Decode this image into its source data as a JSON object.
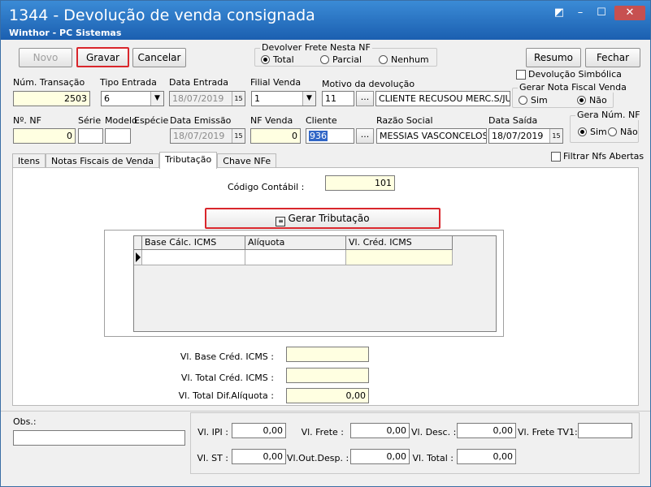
{
  "window": {
    "title": "1344 - Devolução de venda consignada",
    "subtitle": "Winthor - PC Sistemas"
  },
  "toolbar": {
    "novo": "Novo",
    "gravar": "Gravar",
    "cancelar": "Cancelar",
    "resumo": "Resumo",
    "fechar": "Fechar"
  },
  "frete": {
    "title": "Devolver Frete Nesta NF",
    "options": [
      "Total",
      "Parcial",
      "Nenhum"
    ],
    "selected": "Total"
  },
  "devolucao_simbolica": "Devolução Simbólica",
  "gerar_nota": {
    "title": "Gerar Nota Fiscal Venda",
    "options": [
      "Sim",
      "Não"
    ],
    "selected": "Não"
  },
  "gera_num_nf": {
    "title": "Gera Núm. NF",
    "options": [
      "Sim",
      "Não"
    ],
    "selected": "Sim"
  },
  "header": {
    "num_transacao_label": "Núm. Transação",
    "num_transacao": "2503",
    "tipo_entrada_label": "Tipo Entrada",
    "tipo_entrada": "6",
    "data_entrada_label": "Data Entrada",
    "data_entrada": "18/07/2019",
    "filial_venda_label": "Filial Venda",
    "filial_venda": "1",
    "motivo_label": "Motivo da devolução",
    "motivo_codigo": "11",
    "motivo_descricao": "CLIENTE RECUSOU MERC.S/JUSTI",
    "num_nf_label": "Nº. NF",
    "num_nf": "0",
    "serie_label": "Série",
    "serie": "",
    "modelo_label": "Modelo",
    "modelo": "",
    "especie_label": "Espécie",
    "especie": "",
    "data_emissao_label": "Data Emissão",
    "data_emissao": "18/07/2019",
    "nf_venda_label": "NF Venda",
    "nf_venda": "0",
    "cliente_label": "Cliente",
    "cliente": "936",
    "razao_social_label": "Razão Social",
    "razao_social": "MESSIAS VASCONCELOS",
    "data_saida_label": "Data Saída",
    "data_saida": "18/07/2019",
    "ellipsis": "..."
  },
  "filtrar_nfs": "Filtrar Nfs Abertas",
  "tabs": [
    "Itens",
    "Notas Fiscais de Venda",
    "Tributação",
    "Chave NFe"
  ],
  "active_tab": "Tributação",
  "tributacao": {
    "codigo_contabil_label": "Código Contábil :",
    "codigo_contabil": "101",
    "gerar_button": "Gerar Tributação",
    "grid_columns": [
      "Base Cálc. ICMS",
      "Alíquota",
      "Vl. Créd. ICMS"
    ],
    "vl_base_cred_label": "Vl. Base Créd. ICMS :",
    "vl_base_cred": "",
    "vl_total_cred_label": "Vl. Total Créd. ICMS :",
    "vl_total_cred": "",
    "vl_total_dif_label": "Vl. Total Dif.Alíquota :",
    "vl_total_dif": "0,00"
  },
  "footer": {
    "obs_label": "Obs.:",
    "obs": "",
    "vl_ipi_label": "Vl. IPI :",
    "vl_ipi": "0,00",
    "vl_frete_label": "Vl. Frete :",
    "vl_frete": "0,00",
    "vl_desc_label": "Vl. Desc. :",
    "vl_desc": "0,00",
    "vl_frete_tv1_label": "Vl. Frete TV1:",
    "vl_frete_tv1": "",
    "vl_st_label": "Vl. ST :",
    "vl_st": "0,00",
    "vl_out_desp_label": "Vl.Out.Desp. :",
    "vl_out_desp": "0,00",
    "vl_total_label": "Vl. Total :",
    "vl_total": "0,00"
  },
  "colors": {
    "title_bar": "#1b5fb0",
    "highlight_red": "#d9262c",
    "readonly_yellow": "#ffffe1",
    "selection_blue": "#3166c6"
  }
}
